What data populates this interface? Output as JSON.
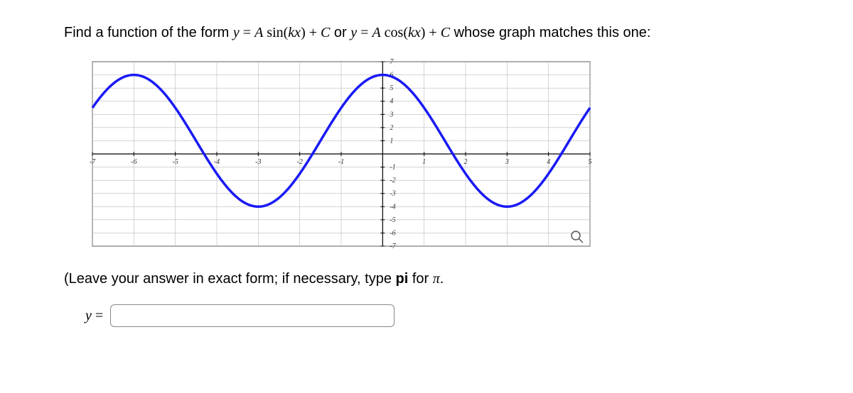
{
  "question": {
    "prefix": "Find a function of the form ",
    "eq1_y": "y",
    "eq1_eq": " = ",
    "eq1_rhs": "A",
    "eq1_sin": " sin(",
    "eq1_kx": "kx",
    "eq1_close": ") + ",
    "eq1_C": "C",
    "or": " or ",
    "eq2_y": "y",
    "eq2_eq": " = ",
    "eq2_rhs": "A",
    "eq2_cos": " cos(",
    "eq2_kx": "kx",
    "eq2_close": ") + ",
    "eq2_C": "C",
    "suffix": " whose graph matches this one:"
  },
  "instruction": {
    "prefix": "(Leave your answer in exact form; if necessary, type ",
    "pi_word": "pi",
    "mid": " for ",
    "pi_sym": "π",
    "suffix": "."
  },
  "answer": {
    "label_y": "y",
    "label_eq": " = ",
    "value": ""
  },
  "chart_data": {
    "type": "line",
    "title": "",
    "xlabel": "",
    "ylabel": "",
    "xlim": [
      -7,
      5
    ],
    "ylim": [
      -7,
      7
    ],
    "xticks": [
      -7,
      -6,
      -5,
      -4,
      -3,
      -2,
      -1,
      1,
      2,
      3,
      4,
      5
    ],
    "yticks": [
      -7,
      -6,
      -5,
      -4,
      -3,
      -2,
      -1,
      1,
      2,
      3,
      4,
      5,
      6,
      7
    ],
    "grid": true,
    "series": [
      {
        "name": "curve",
        "color": "#1a1af5",
        "function": "5*sin(1.047*x) + 1",
        "points": [
          {
            "x": -7,
            "y": 3.5
          },
          {
            "x": -6.5,
            "y": 5.33
          },
          {
            "x": -6,
            "y": 6
          },
          {
            "x": -5.5,
            "y": 5.33
          },
          {
            "x": -5,
            "y": 3.5
          },
          {
            "x": -4.5,
            "y": 1
          },
          {
            "x": -4,
            "y": -1.5
          },
          {
            "x": -3.5,
            "y": -3.33
          },
          {
            "x": -3,
            "y": -4
          },
          {
            "x": -2.5,
            "y": -3.33
          },
          {
            "x": -2,
            "y": -1.5
          },
          {
            "x": -1.5,
            "y": 1
          },
          {
            "x": -1,
            "y": 3.5
          },
          {
            "x": -0.5,
            "y": 5.33
          },
          {
            "x": 0,
            "y": 6
          },
          {
            "x": 0.5,
            "y": 5.33
          },
          {
            "x": 1,
            "y": 3.5
          },
          {
            "x": 1.5,
            "y": 1
          },
          {
            "x": 2,
            "y": -1.5
          },
          {
            "x": 2.5,
            "y": -3.33
          },
          {
            "x": 3,
            "y": -4
          },
          {
            "x": 3.5,
            "y": -3.33
          },
          {
            "x": 4,
            "y": -1.5
          },
          {
            "x": 4.5,
            "y": 1
          },
          {
            "x": 5,
            "y": 3.5
          }
        ]
      }
    ]
  }
}
